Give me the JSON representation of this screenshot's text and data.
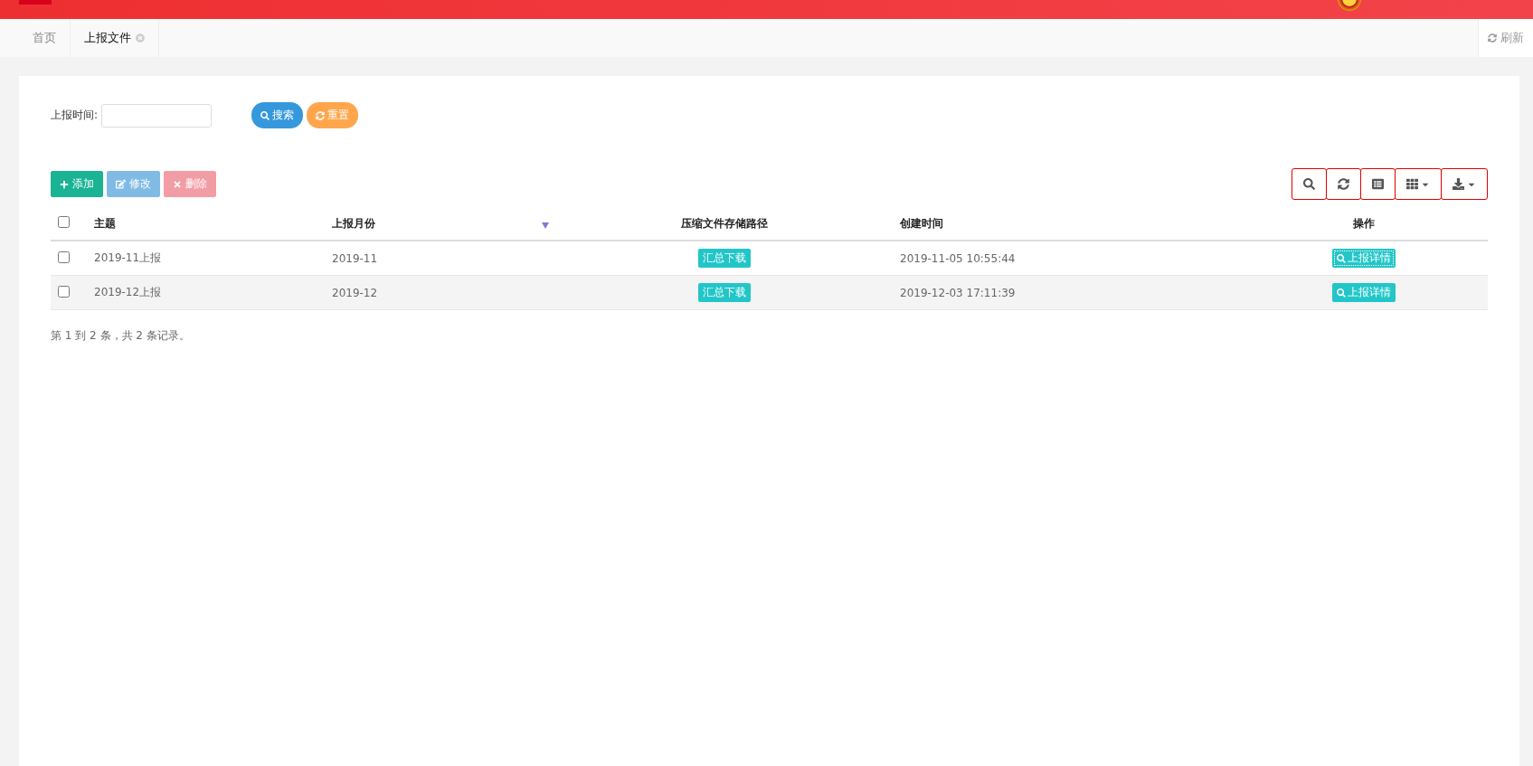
{
  "tabs": [
    {
      "label": "首页",
      "selected": false,
      "closable": false
    },
    {
      "label": "上报文件",
      "selected": true,
      "closable": true
    }
  ],
  "refresh": "刷新",
  "filter": {
    "label": "上报时间:",
    "search": "搜索",
    "reset": "重置"
  },
  "actions": [
    {
      "label": "添加",
      "kind": "add",
      "disabled": false
    },
    {
      "label": "修改",
      "kind": "edit",
      "disabled": true
    },
    {
      "label": "删除",
      "kind": "delete",
      "disabled": true
    }
  ],
  "tools": [
    {
      "kind": "search",
      "dropdown": false
    },
    {
      "kind": "refresh",
      "dropdown": false
    },
    {
      "kind": "toggle",
      "dropdown": false
    },
    {
      "kind": "columns",
      "dropdown": true
    },
    {
      "kind": "export",
      "dropdown": true
    }
  ],
  "table": {
    "select_all": false,
    "columns": [
      "主题",
      "上报月份",
      "压缩文件存储路径",
      "创建时间",
      "操作"
    ],
    "rows": [
      {
        "checked": false,
        "subject": "2019-11上报",
        "month": "2019-11",
        "download": "汇总下载",
        "created": "2019-11-05 10:55:44",
        "detail": "上报详情",
        "focused": true
      },
      {
        "checked": false,
        "subject": "2019-12上报",
        "month": "2019-12",
        "download": "汇总下载",
        "created": "2019-12-03 17:11:39",
        "detail": "上报详情",
        "focused": false
      }
    ]
  },
  "pagination": "第 1 到 2 条，共 2 条记录。"
}
